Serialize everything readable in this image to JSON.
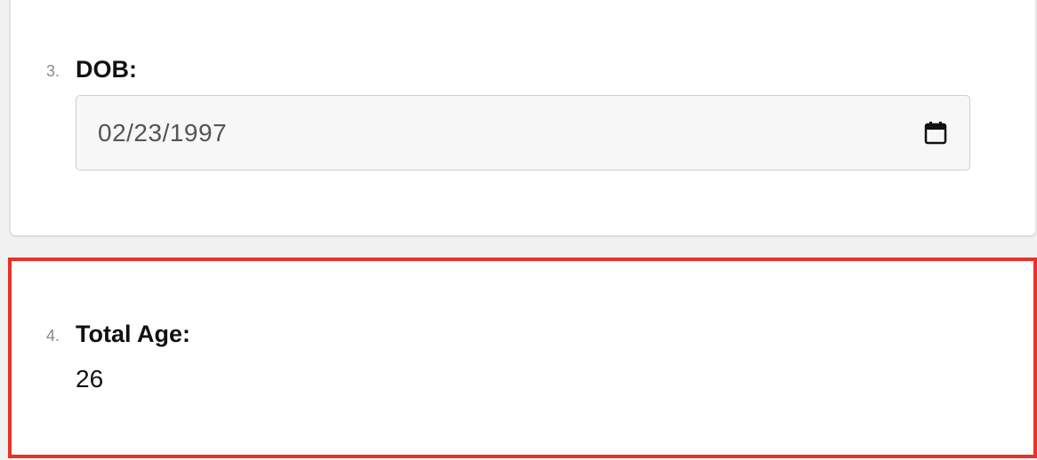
{
  "questions": [
    {
      "number": "3.",
      "label": "DOB:",
      "field": {
        "value": "02/23/1997",
        "icon": "calendar-icon"
      }
    },
    {
      "number": "4.",
      "label": "Total Age:",
      "value": "26"
    }
  ],
  "colors": {
    "highlight_border": "#e5332a",
    "card_background": "#ffffff",
    "page_background": "#f1f1f1"
  }
}
